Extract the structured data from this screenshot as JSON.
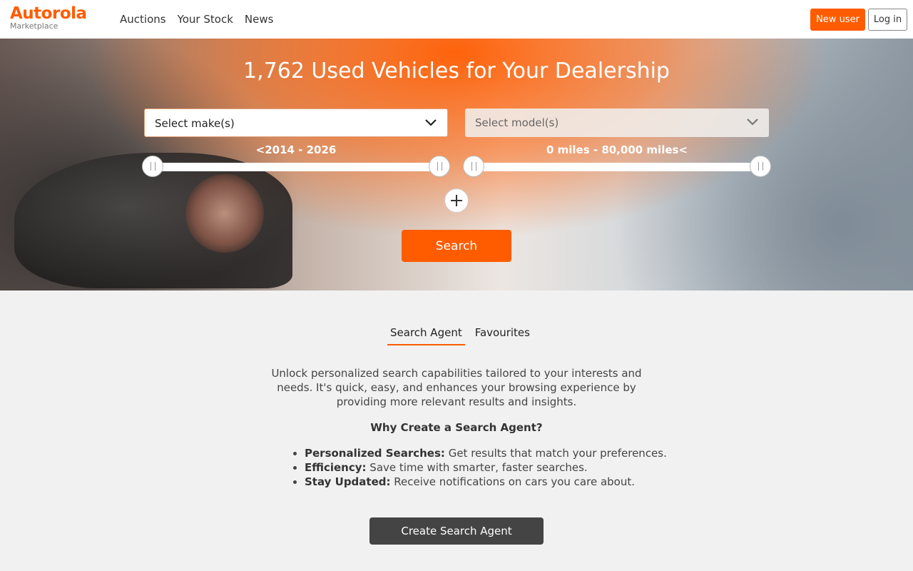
{
  "header": {
    "logo_main": "Autorola",
    "logo_sub": "Marketplace",
    "nav": [
      "Auctions",
      "Your Stock",
      "News"
    ],
    "new_user": "New user",
    "login": "Log in"
  },
  "hero": {
    "title": "1,762 Used Vehicles for Your Dealership",
    "make_placeholder": "Select make(s)",
    "model_placeholder": "Select model(s)",
    "year_range": "<2014 - 2026",
    "mileage_range": "0 miles - 80,000 miles<",
    "search_label": "Search"
  },
  "tabs": [
    "Search Agent",
    "Favourites"
  ],
  "agent": {
    "description": "Unlock personalized search capabilities tailored to your interests and needs. It's quick, easy, and enhances your browsing experience by providing more relevant results and insights.",
    "why_title": "Why Create a Search Agent?",
    "benefits": [
      {
        "title": "Personalized Searches:",
        "text": " Get results that match your preferences."
      },
      {
        "title": "Efficiency:",
        "text": " Save time with smarter, faster searches."
      },
      {
        "title": "Stay Updated:",
        "text": " Receive notifications on cars you care about."
      }
    ],
    "create_label": "Create Search Agent"
  },
  "colors": {
    "accent": "#ff5c00",
    "dark_button": "#444444"
  }
}
